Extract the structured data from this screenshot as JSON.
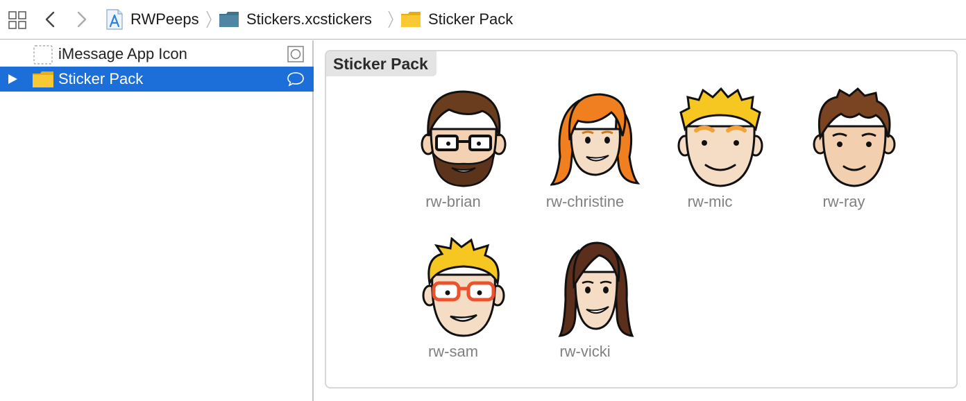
{
  "jumpbar": {
    "breadcrumbs": [
      {
        "label": "RWPeeps",
        "icon": "xcode-project-icon"
      },
      {
        "label": "Stickers.xcstickers",
        "icon": "asset-catalog-folder-icon"
      },
      {
        "label": "Sticker Pack",
        "icon": "folder-icon"
      }
    ]
  },
  "sidebar": {
    "items": [
      {
        "label": "iMessage App Icon",
        "icon": "dashed-placeholder-icon",
        "accessory": "app-icon-set-icon"
      },
      {
        "label": "Sticker Pack",
        "icon": "folder-icon",
        "accessory": "message-bubble-icon",
        "selected": true
      }
    ]
  },
  "main": {
    "panel_title": "Sticker Pack",
    "stickers": [
      {
        "name": "rw-brian"
      },
      {
        "name": "rw-christine"
      },
      {
        "name": "rw-mic"
      },
      {
        "name": "rw-ray"
      },
      {
        "name": "rw-sam"
      },
      {
        "name": "rw-vicki"
      }
    ]
  },
  "colors": {
    "selection": "#1c6fd8",
    "folder": "#f8c935",
    "sticker_label": "#808080"
  }
}
